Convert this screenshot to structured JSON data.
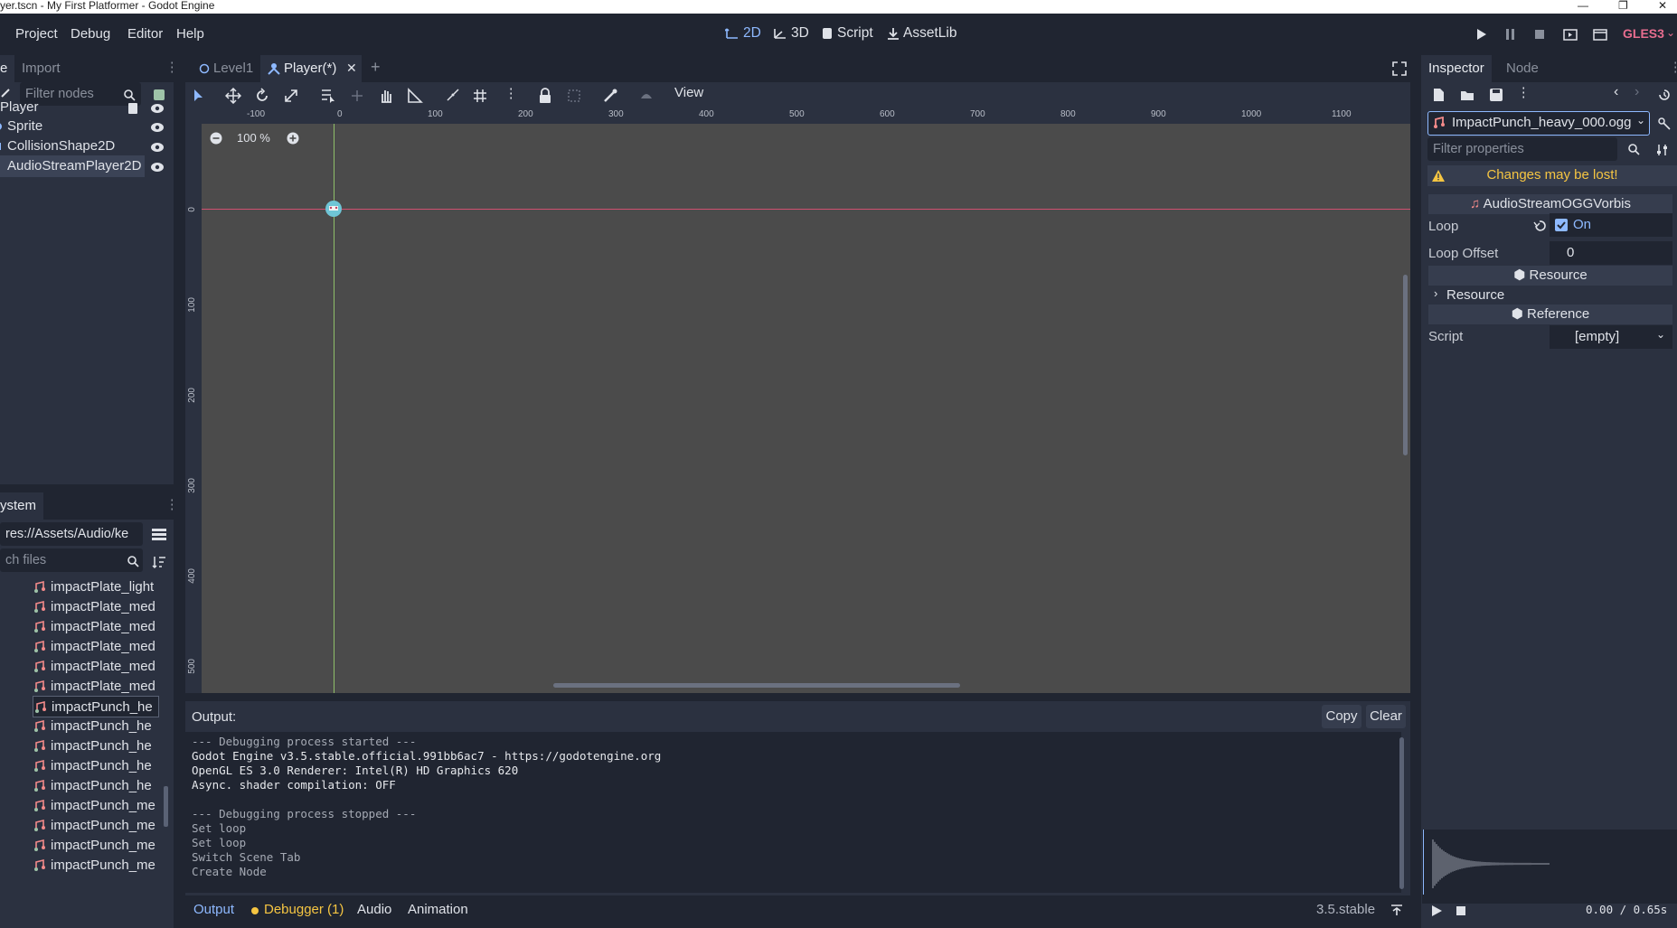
{
  "window": {
    "title": "yer.tscn - My First Platformer - Godot Engine"
  },
  "menu": [
    "Project",
    "Debug",
    "Editor",
    "Help"
  ],
  "workspaces": [
    {
      "label": "2D",
      "icon": "2d-icon",
      "active": true
    },
    {
      "label": "3D",
      "icon": "3d-icon",
      "active": false
    },
    {
      "label": "Script",
      "icon": "script-icon",
      "active": false
    },
    {
      "label": "AssetLib",
      "icon": "assetlib-icon",
      "active": false
    }
  ],
  "renderer": "GLES3",
  "scene_dock": {
    "tabs": [
      "e",
      "Import"
    ],
    "filter_placeholder": "Filter nodes",
    "nodes": [
      "Player",
      "Sprite",
      "CollisionShape2D",
      "AudioStreamPlayer2D"
    ]
  },
  "filesystem": {
    "tab": "ystem",
    "path": "res://Assets/Audio/ke",
    "search_placeholder": "ch files",
    "files": [
      "impactPlate_light",
      "impactPlate_med",
      "impactPlate_med",
      "impactPlate_med",
      "impactPlate_med",
      "impactPlate_med",
      "impactPunch_he",
      "impactPunch_he",
      "impactPunch_he",
      "impactPunch_he",
      "impactPunch_he",
      "impactPunch_me",
      "impactPunch_me",
      "impactPunch_me",
      "impactPunch_me"
    ]
  },
  "scene_tabs": [
    "Level1",
    "Player(*)"
  ],
  "viewport": {
    "zoom": "100 %",
    "view_menu": "View",
    "ruler_h": [
      "-100",
      "0",
      "100",
      "200",
      "300",
      "400",
      "500",
      "600",
      "700",
      "800",
      "900",
      "1000",
      "1100"
    ],
    "ruler_v": [
      "0",
      "100",
      "200",
      "300",
      "400",
      "500"
    ]
  },
  "output": {
    "title": "Output:",
    "copy": "Copy",
    "clear": "Clear",
    "lines": [
      {
        "text": "--- Debugging process started ---",
        "dim": true
      },
      {
        "text": "Godot Engine v3.5.stable.official.991bb6ac7 - https://godotengine.org",
        "dim": false
      },
      {
        "text": "OpenGL ES 3.0 Renderer: Intel(R) HD Graphics 620",
        "dim": false
      },
      {
        "text": "Async. shader compilation: OFF",
        "dim": false
      },
      {
        "text": "",
        "dim": false
      },
      {
        "text": "--- Debugging process stopped ---",
        "dim": true
      },
      {
        "text": "Set loop",
        "dim": true
      },
      {
        "text": "Set loop",
        "dim": true
      },
      {
        "text": "Switch Scene Tab",
        "dim": true
      },
      {
        "text": "Create Node",
        "dim": true
      }
    ]
  },
  "bottom_tabs": {
    "output": "Output",
    "debugger": "Debugger (1)",
    "audio": "Audio",
    "animation": "Animation",
    "version": "3.5.stable"
  },
  "inspector": {
    "tabs": [
      "Inspector",
      "Node"
    ],
    "resource": "ImpactPunch_heavy_000.ogg",
    "filter_placeholder": "Filter properties",
    "warning": "Changes may be lost!",
    "class_header": "AudioStreamOGGVorbis",
    "loop_label": "Loop",
    "loop_value": "On",
    "loop_offset_label": "Loop Offset",
    "loop_offset_value": "0",
    "resource_header": "Resource",
    "resource_group": "Resource",
    "reference_header": "Reference",
    "script_label": "Script",
    "script_value": "[empty]",
    "time": "0.00 / 0.65s",
    "colors": {
      "warning": "#f5c542",
      "accent": "#8eb9ff"
    }
  }
}
